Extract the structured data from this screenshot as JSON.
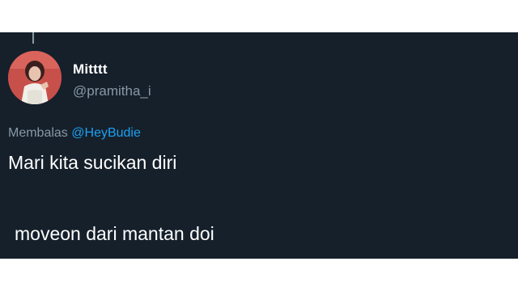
{
  "tweet": {
    "display_name": "Mitttt",
    "handle": "@pramitha_i",
    "reply_prefix": "Membalas",
    "reply_mention": "@HeyBudie",
    "text_lines": [
      "Mari kita sucikan diri",
      "moveon dari mantan doi"
    ]
  },
  "colors": {
    "background": "#15202b",
    "secondary_text": "#8899a6",
    "mention": "#1da1f2",
    "primary_text": "#ffffff"
  },
  "icons": {
    "avatar": "profile-photo"
  }
}
